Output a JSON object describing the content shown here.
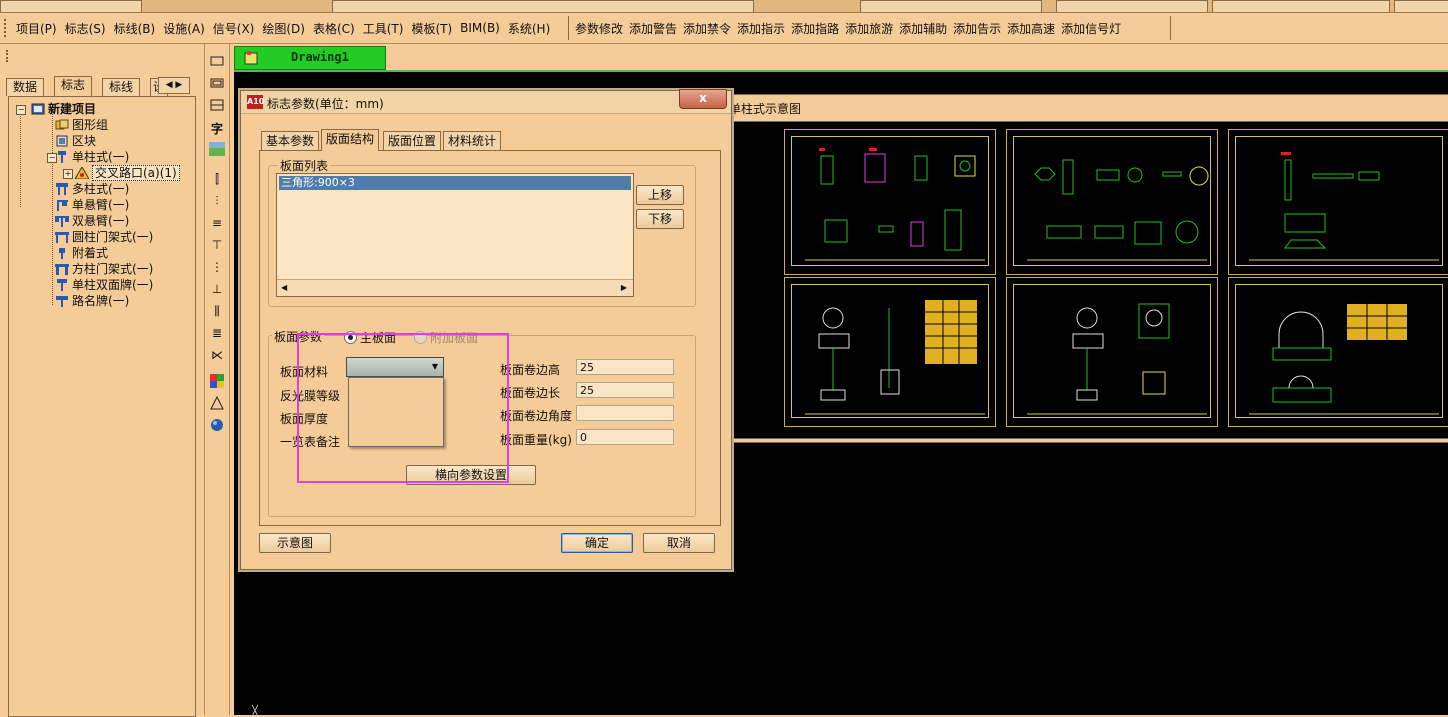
{
  "menu": {
    "main": [
      "项目(P)",
      "标志(S)",
      "标线(B)",
      "设施(A)",
      "信号(X)",
      "绘图(D)",
      "表格(C)",
      "工具(T)",
      "模板(T)",
      "BIM(B)",
      "系统(H)"
    ],
    "extensions": [
      "参数修改",
      "添加警告",
      "添加禁令",
      "添加指示",
      "添加指路",
      "添加旅游",
      "添加辅助",
      "添加告示",
      "添加高速",
      "添加信号灯"
    ]
  },
  "left_panel": {
    "tabs": [
      "数据",
      "标志",
      "标线",
      "设"
    ],
    "active_tab": "标志",
    "tree": {
      "root": "新建项目",
      "items": [
        "图形组",
        "区块",
        "单柱式(一)",
        "交叉路口(a)(1)",
        "多柱式(一)",
        "单悬臂(一)",
        "双悬臂(一)",
        "圆柱门架式(一)",
        "附着式",
        "方柱门架式(一)",
        "单柱双面牌(一)",
        "路名牌(一)"
      ]
    }
  },
  "drawing": {
    "tab_title": "Drawing1"
  },
  "dialog": {
    "title": "标志参数(单位：mm)",
    "close": "x",
    "tabs": [
      "基本参数",
      "版面结构",
      "版面位置",
      "材料统计"
    ],
    "active_tab": "版面结构",
    "panel_list": {
      "group_title": "板面列表",
      "rows": [
        "三角形:900×3"
      ],
      "move_up": "上移",
      "move_down": "下移"
    },
    "panel_params": {
      "group_title": "板面参数",
      "radio_main": "主板面",
      "radio_extra": "附加板面",
      "labels": [
        "板面材料",
        "反光膜等级",
        "板面厚度",
        "一览表备注"
      ],
      "right_labels": [
        "板面卷边高",
        "板面卷边长",
        "板面卷边角度",
        "板面重量(kg)"
      ],
      "right_values": [
        "25",
        "25",
        "",
        "0"
      ],
      "extra_button": "横向参数设置"
    },
    "buttons": {
      "preview": "示意图",
      "ok": "确定",
      "cancel": "取消"
    }
  },
  "preview_window": {
    "title": "单柱式示意图"
  }
}
